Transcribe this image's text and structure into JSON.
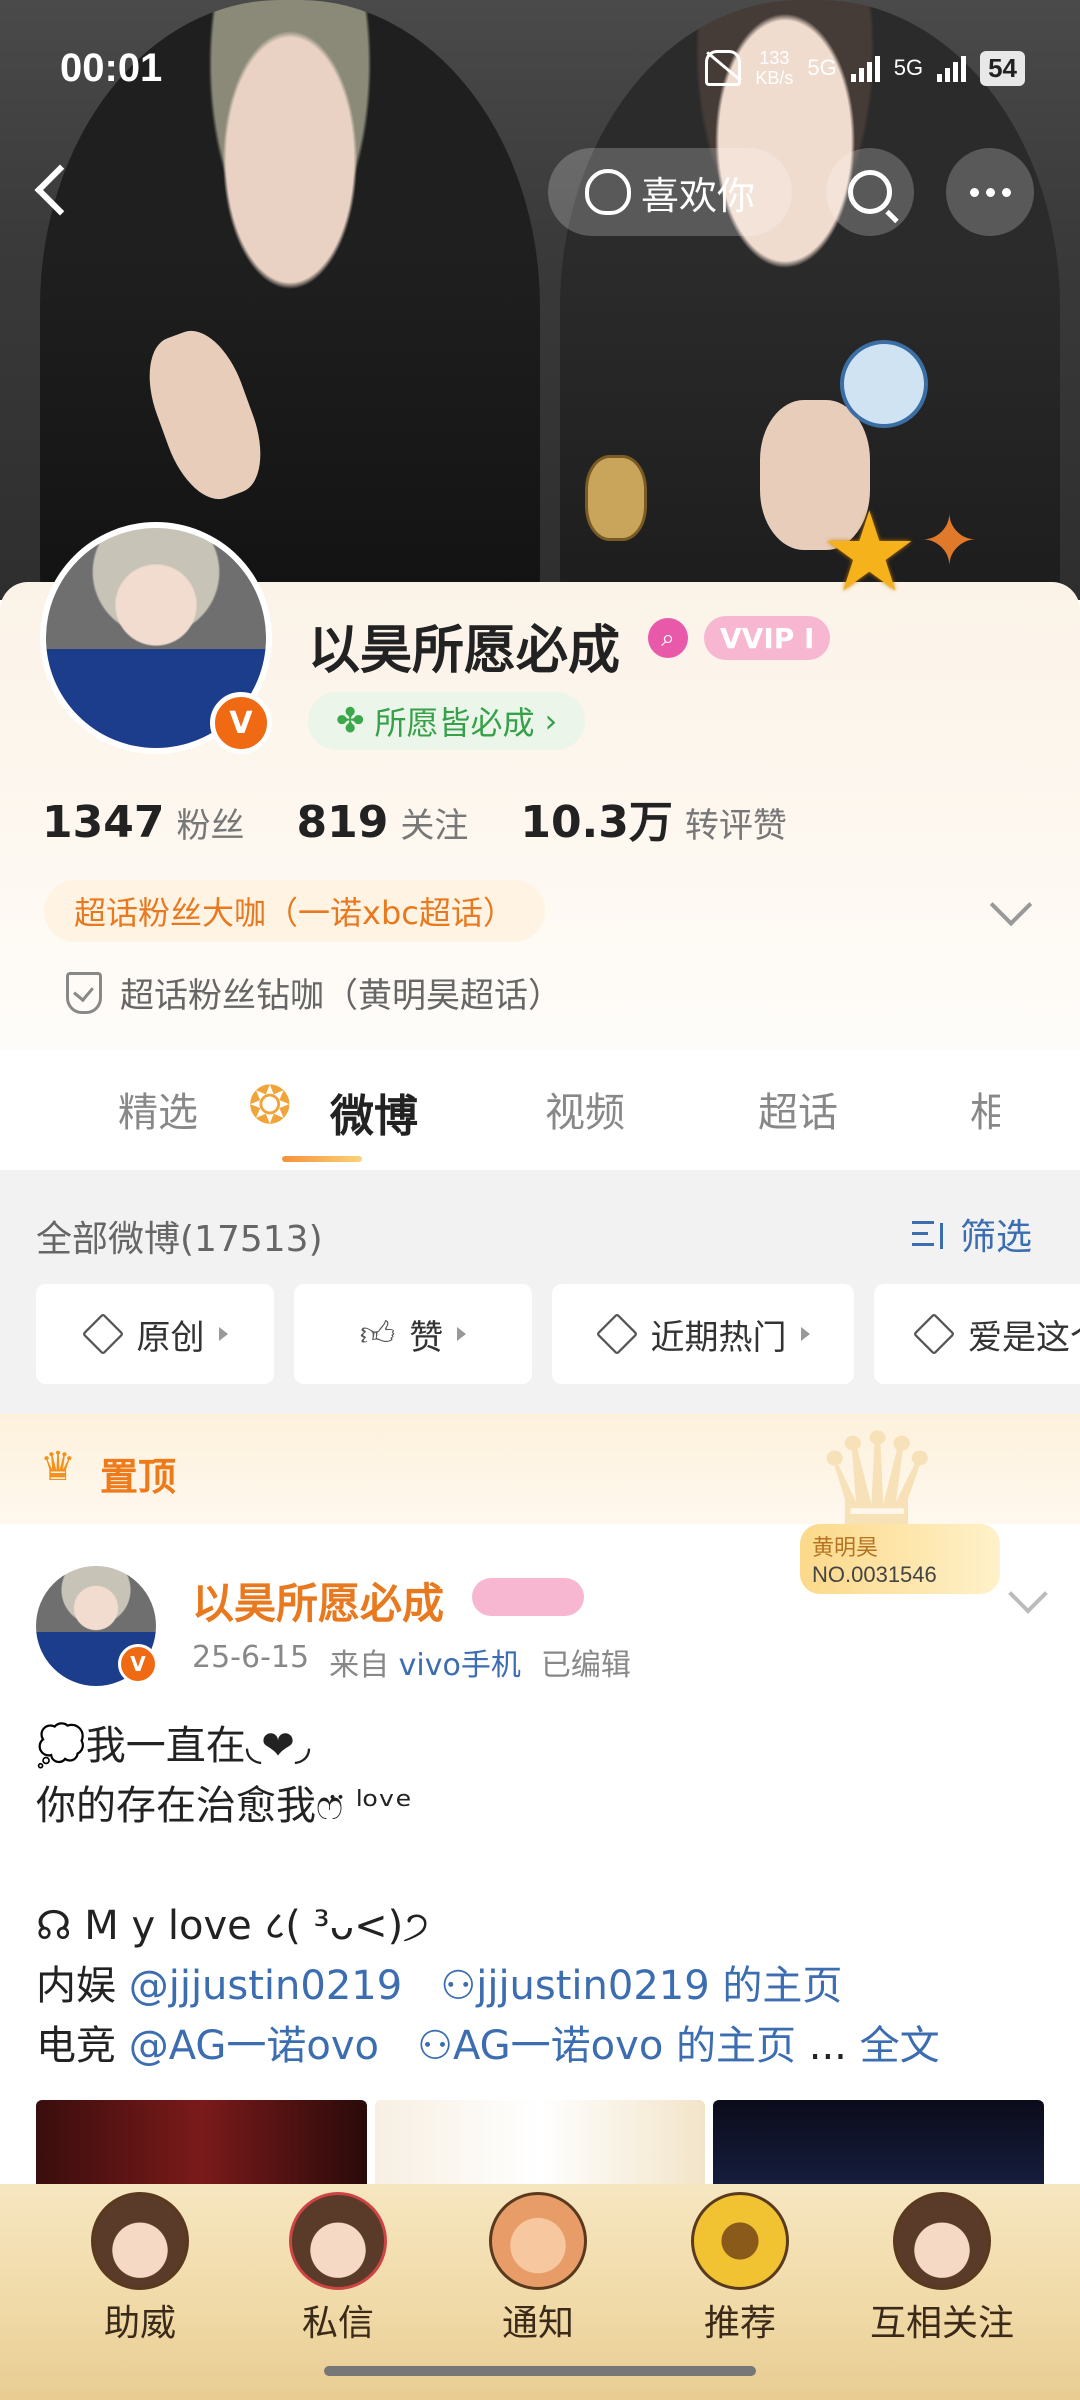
{
  "status_bar": {
    "time": "00:01",
    "net_speed_top": "133",
    "net_speed_bottom": "KB/s",
    "signal_1": "5G",
    "signal_2": "5G",
    "battery": "54"
  },
  "nav": {
    "like_label": "喜欢你"
  },
  "profile": {
    "name": "以昊所愿必成",
    "verified_mark": "V",
    "vip_label": "VVIP I",
    "bio": "所愿皆必成",
    "bio_suffix": "›",
    "stats": [
      {
        "num": "1347",
        "label": "粉丝"
      },
      {
        "num": "819",
        "label": "关注"
      },
      {
        "num": "10.3万",
        "label": "转评赞"
      }
    ],
    "fan_title_1": "超话粉丝大咖（一诺xbc超话）",
    "fan_title_2": "超话粉丝钻咖（黄明昊超话）"
  },
  "tabs": [
    "精选",
    "微博",
    "视频",
    "超话",
    "相"
  ],
  "filter": {
    "all_weibo": "全部微博(17513)",
    "filter_label": "筛选",
    "chips": [
      "原创",
      "赞",
      "近期热门",
      "爱是这个"
    ]
  },
  "pinned": {
    "label": "置顶",
    "fan_card_name": "黄明昊",
    "fan_card_no": "NO.0031546"
  },
  "post": {
    "author": "以昊所愿必成",
    "date": "25-6-15",
    "source_prefix": "来自",
    "source": "vivo手机",
    "edited": "已编辑",
    "line1": "💭我一直在◟❤︎◞",
    "line2": "你的存在治愈我ෆ̈ ˡᵒᵛᵉ",
    "line3": "☊ M y love ८( ³ᴗ<)੭",
    "line4_prefix": "内娱 ",
    "line4_mention": "@jjjustin0219",
    "line4_link": "jjjustin0219 的主页",
    "line5_prefix": "电竞 ",
    "line5_mention": "@AG一诺ovo",
    "line5_link": "AG一诺ovo 的主页",
    "line5_ellipsis": " ... ",
    "full_text": "全文"
  },
  "bottom_nav": [
    "助威",
    "私信",
    "通知",
    "推荐",
    "互相关注"
  ],
  "colors": {
    "accent_orange": "#ee7a1a",
    "link_blue": "#3b6db0",
    "verified_orange": "#f06a14"
  }
}
